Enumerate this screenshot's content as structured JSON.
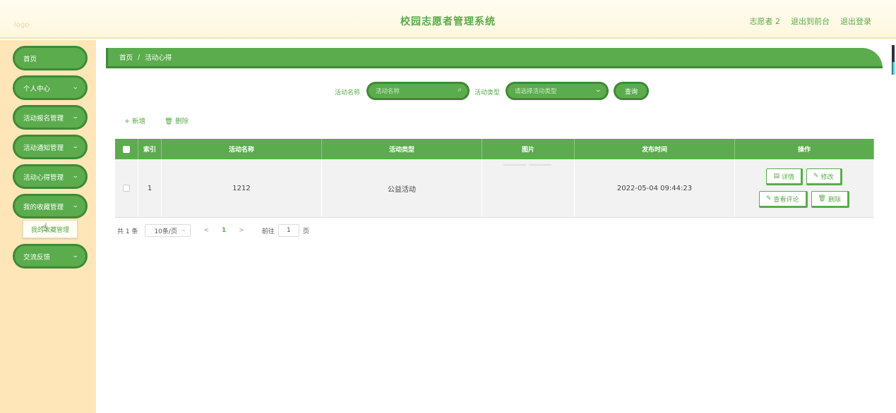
{
  "header": {
    "logo_text": "logo",
    "title": "校园志愿者管理系统",
    "user": "志愿者 2",
    "back_front": "退出到前台",
    "logout": "退出登录"
  },
  "sidebar": {
    "items": [
      {
        "label": "首页"
      },
      {
        "label": "个人中心"
      },
      {
        "label": "活动报名管理"
      },
      {
        "label": "活动通知管理"
      },
      {
        "label": "活动心得管理"
      },
      {
        "label": "我的收藏管理"
      },
      {
        "label": "交流反馈"
      }
    ],
    "submenu_label": "我的收藏管理"
  },
  "breadcrumb": {
    "home": "首页",
    "sep": "/",
    "current": "活动心得"
  },
  "search": {
    "name_label": "活动名称",
    "name_placeholder": "活动名称",
    "type_label": "活动类型",
    "type_placeholder": "请选择活动类型",
    "query_label": "查询"
  },
  "toolbar": {
    "add_label": "+ 新增",
    "delete_label": "🗑 删除"
  },
  "table": {
    "headers": [
      "索引",
      "活动名称",
      "活动类型",
      "图片",
      "发布时间",
      "操作"
    ],
    "rows": [
      {
        "index": "1",
        "name": "1212",
        "type": "公益活动",
        "pic": "",
        "time": "2022-05-04 09:44:23"
      }
    ],
    "ops": {
      "detail": "详情",
      "edit": "修改",
      "comments": "查看评论",
      "delete": "删除"
    }
  },
  "pager": {
    "total": "共 1 条",
    "size": "10条/页",
    "prev": "<",
    "page": "1",
    "next": ">",
    "goto": "前往",
    "goto_value": "1",
    "page_word": "页"
  },
  "colors": {
    "primary": "#5aac4d",
    "primary_dark": "#3f8a34",
    "sidebar_bg": "#ffe6b8",
    "header_bg": "#fff6dd"
  }
}
